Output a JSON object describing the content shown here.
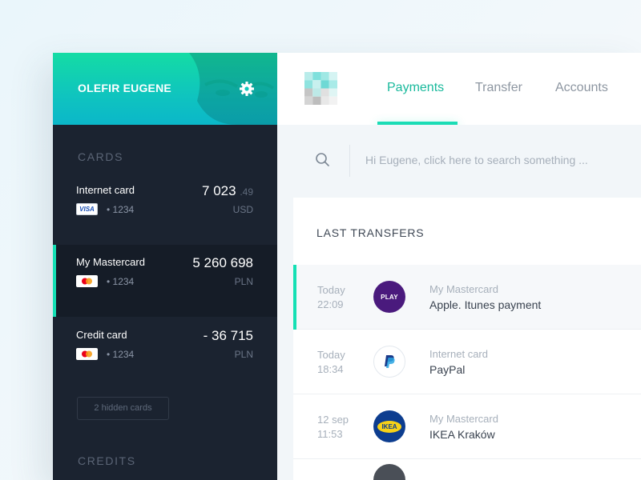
{
  "profile": {
    "name": "OLEFIR EUGENE",
    "settings_icon": "gear-icon"
  },
  "sidebar": {
    "cards_label": "CARDS",
    "cards": [
      {
        "name": "Internet card",
        "brand": "visa",
        "brand_label": "VISA",
        "number": "• 1234",
        "amount": "7 023",
        "cents": ".49",
        "currency": "USD",
        "active": false
      },
      {
        "name": "My Mastercard",
        "brand": "mastercard",
        "number": "• 1234",
        "amount": "5 260 698",
        "cents": "",
        "currency": "PLN",
        "active": true
      },
      {
        "name": "Credit card",
        "brand": "mastercard",
        "number": "• 1234",
        "amount": "- 36 715",
        "cents": "",
        "currency": "PLN",
        "active": false
      }
    ],
    "hidden_cards_label": "2 hidden cards",
    "credits_label": "CREDITS"
  },
  "header": {
    "logo_icon": "pixel-logo-icon",
    "tabs": [
      {
        "label": "Payments",
        "active": true
      },
      {
        "label": "Transfer",
        "active": false
      },
      {
        "label": "Accounts",
        "active": false
      }
    ]
  },
  "search": {
    "icon": "search-icon",
    "placeholder": "Hi Eugene, click here to search something ..."
  },
  "transfers": {
    "title": "LAST TRANSFERS",
    "rows": [
      {
        "day": "Today",
        "time": "22:09",
        "icon": "play-logo-icon",
        "logo_text": "PLAY",
        "source": "My Mastercard",
        "description": "Apple. Itunes payment",
        "active": true
      },
      {
        "day": "Today",
        "time": "18:34",
        "icon": "paypal-logo-icon",
        "source": "Internet card",
        "description": "PayPal",
        "active": false
      },
      {
        "day": "12 sep",
        "time": "11:53",
        "icon": "ikea-logo-icon",
        "logo_text": "IKEA",
        "source": "My Mastercard",
        "description": "IKEA Kraków",
        "active": false
      }
    ]
  },
  "colors": {
    "accent": "#14e0b4",
    "sidebar_bg": "#1b2330",
    "tab_active": "#19b99c",
    "play_purple": "#4a1a7d",
    "ikea_blue": "#0d3d8f",
    "ikea_yellow": "#f7d117"
  }
}
